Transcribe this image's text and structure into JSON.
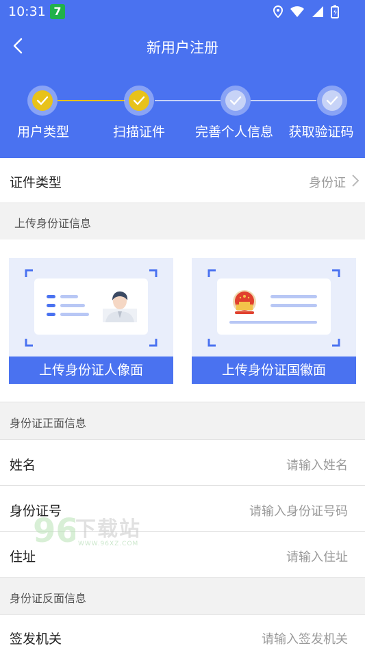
{
  "status_bar": {
    "time": "10:31",
    "badge": "7"
  },
  "nav": {
    "title": "新用户注册"
  },
  "steps": [
    {
      "label": "用户类型",
      "done": true
    },
    {
      "label": "扫描证件",
      "done": true
    },
    {
      "label": "完善个人信息",
      "done": false
    },
    {
      "label": "获取验证码",
      "done": false
    }
  ],
  "doc_type": {
    "label": "证件类型",
    "value": "身份证"
  },
  "upload_section": {
    "title": "上传身份证信息"
  },
  "upload_cards": {
    "front": {
      "button": "上传身份证人像面"
    },
    "back": {
      "button": "上传身份证国徽面"
    }
  },
  "front_section": {
    "title": "身份证正面信息"
  },
  "front_fields": {
    "name": {
      "label": "姓名",
      "placeholder": "请输入姓名"
    },
    "id_number": {
      "label": "身份证号",
      "placeholder": "请输入身份证号码"
    },
    "address": {
      "label": "住址",
      "placeholder": "请输入住址"
    }
  },
  "back_section": {
    "title": "身份证反面信息"
  },
  "back_fields": {
    "authority": {
      "label": "签发机关",
      "placeholder": "请输入签发机关"
    }
  },
  "watermark": {
    "text": "下载站",
    "url": "WWW.96XZ.COM"
  },
  "colors": {
    "primary": "#4a72f0",
    "done": "#e8c21a",
    "pending": "#c7d3f7"
  }
}
